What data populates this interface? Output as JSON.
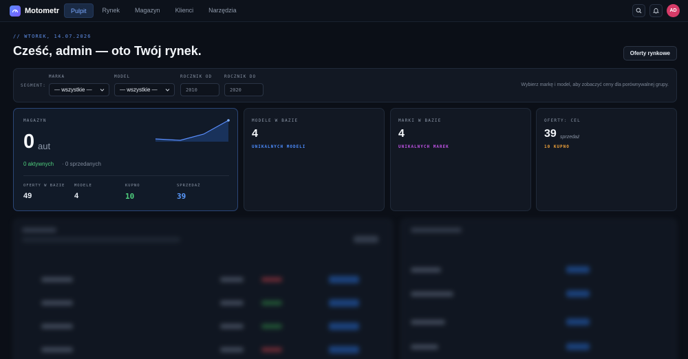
{
  "app": {
    "name": "Motometr",
    "user_initials": "AD"
  },
  "nav": {
    "items": [
      {
        "label": "Pulpit",
        "active": true
      },
      {
        "label": "Rynek",
        "active": false
      },
      {
        "label": "Magazyn",
        "active": false
      },
      {
        "label": "Klienci",
        "active": false
      },
      {
        "label": "Narzędzia",
        "active": false
      }
    ]
  },
  "header": {
    "date_line": "// WTOREK, 14.07.2026",
    "greeting": "Cześć, admin — oto Twój rynek.",
    "offers_button": "Oferty rynkowe"
  },
  "segment": {
    "label": "SEGMENT:",
    "make": {
      "label": "MARKA",
      "value": "— wszystkie —"
    },
    "model": {
      "label": "MODEL",
      "value": "— wszystkie —"
    },
    "year_from": {
      "label": "ROCZNIK OD",
      "placeholder": "2010"
    },
    "year_to": {
      "label": "ROCZNIK DO",
      "placeholder": "2020"
    },
    "hint": "Wybierz markę i model, aby zobaczyć ceny dla porównywalnej grupy."
  },
  "cards": {
    "magazyn": {
      "label": "MAGAZYN",
      "count": "0",
      "unit": "aut",
      "active": "0 aktywnych",
      "sold": "· 0 sprzedanych",
      "stats": [
        {
          "label": "OFERTY W BAZIE",
          "value": "49",
          "color": "#e9eef5"
        },
        {
          "label": "MODELE",
          "value": "4",
          "color": "#e9eef5"
        },
        {
          "label": "KUPNO",
          "value": "10",
          "color": "#4fcf7d"
        },
        {
          "label": "SPRZEDAŻ",
          "value": "39",
          "color": "#5b9bff"
        }
      ]
    },
    "models": {
      "label": "MODELE W BAZIE",
      "value": "4",
      "tag": "UNIKALNYCH MODELI",
      "tag_color": "#4d8dff"
    },
    "brands": {
      "label": "MARKI W BAZIE",
      "value": "4",
      "tag": "UNIKALNYCH MAREK",
      "tag_color": "#c153e6"
    },
    "offers": {
      "label": "OFERTY: CEL",
      "value": "39",
      "value_suffix": "sprzedaż",
      "tag": "10 KUPNO",
      "tag_color": "#f0a23a"
    }
  },
  "colors": {
    "accent": "#4d8dff",
    "background": "#0b0f17",
    "panel": "#121823",
    "avatar": "#d63b68"
  }
}
